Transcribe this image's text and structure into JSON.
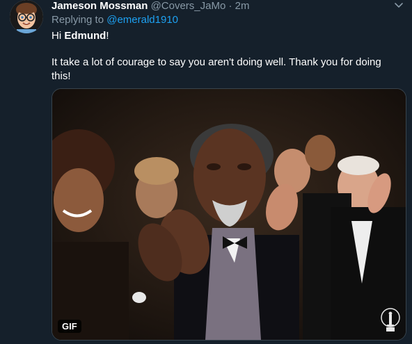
{
  "tweet": {
    "author_name": "Jameson Mossman",
    "author_handle": "@Covers_JaMo",
    "separator": "·",
    "timestamp": "2m",
    "replying_prefix": "Replying to",
    "replying_to": "@emerald1910",
    "greeting_prefix": "Hi",
    "greeting_name": "Edmund",
    "greeting_suffix": "!",
    "message": "It take a lot of courage to say you aren't doing well. Thank you for doing this!"
  },
  "media": {
    "badge": "GIF",
    "kind": "gif"
  },
  "icons": {
    "avatar": "memoji-avatar",
    "more": "chevron-down-icon",
    "watermark": "oscar-statuette-icon"
  },
  "colors": {
    "background": "#15202b",
    "secondary_text": "#8899a6",
    "link": "#1da1f2"
  }
}
